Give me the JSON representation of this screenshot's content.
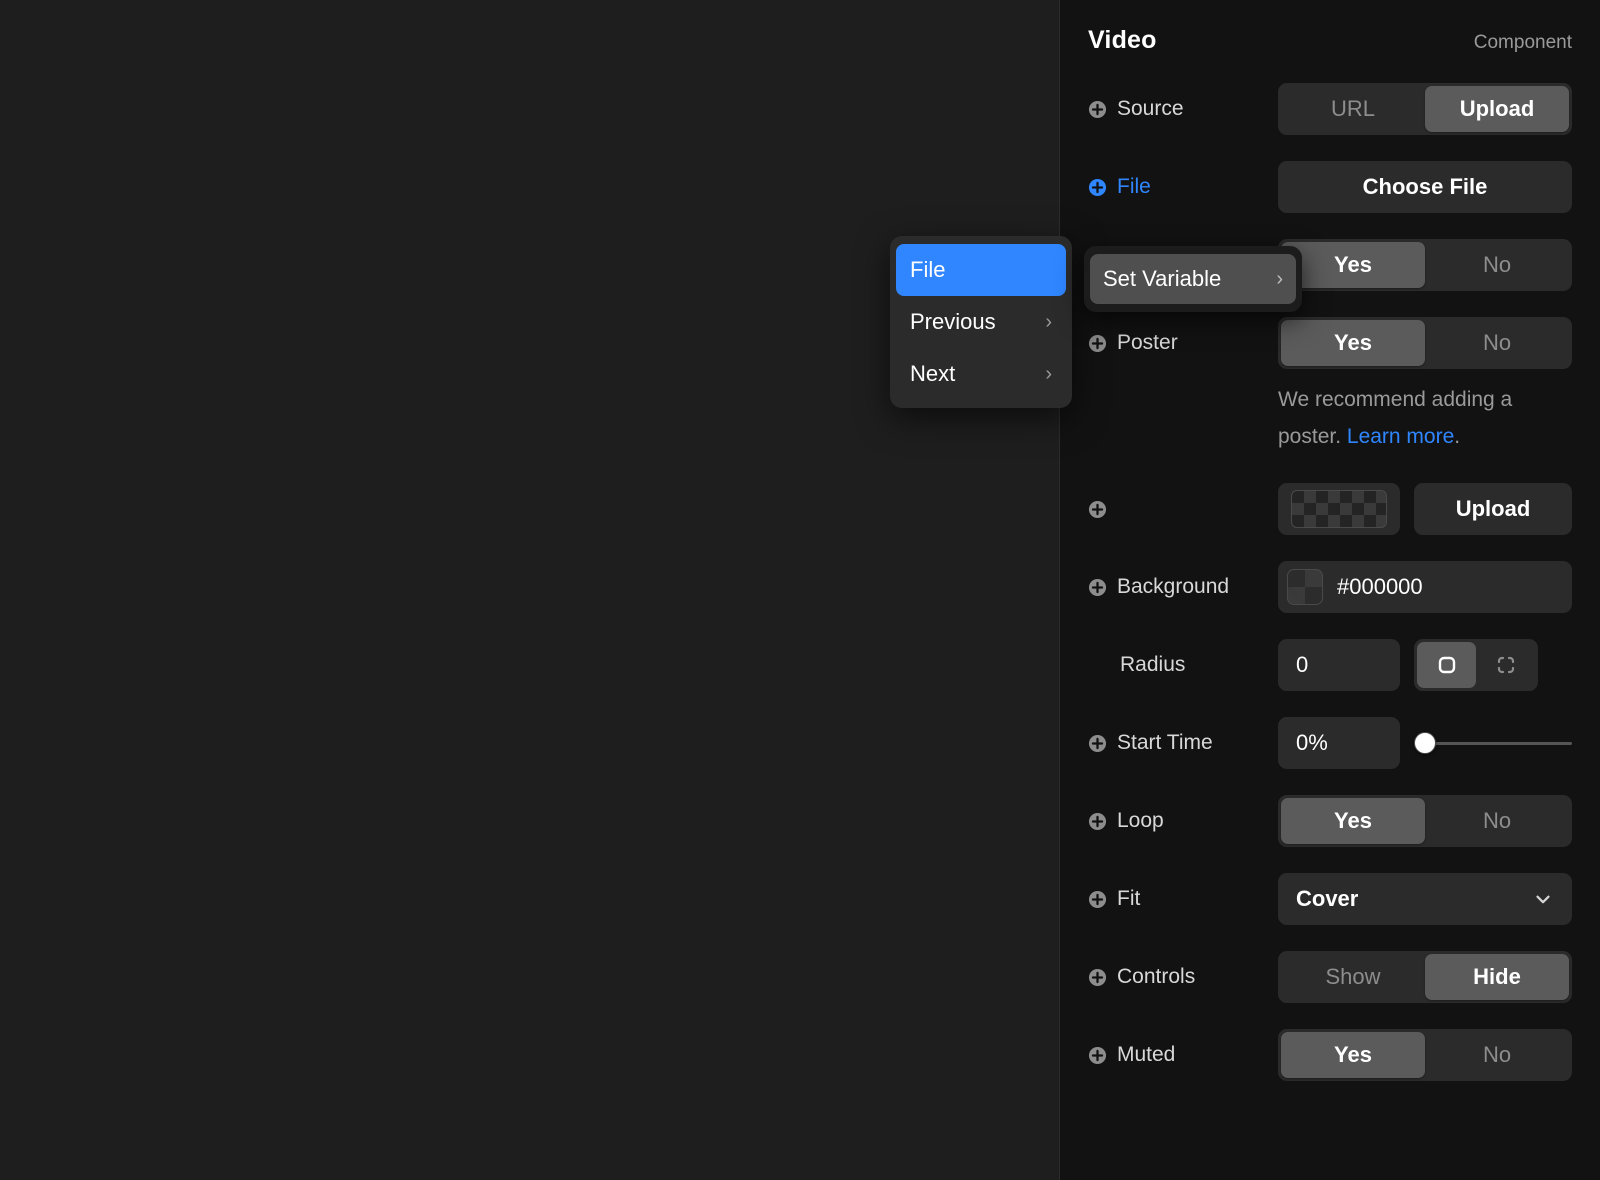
{
  "panel": {
    "title": "Video",
    "kind": "Component"
  },
  "rows": {
    "source": {
      "label": "Source",
      "options": [
        "URL",
        "Upload"
      ],
      "selected": "Upload"
    },
    "file": {
      "label": "File",
      "button": "Choose File"
    },
    "set_variable_row": {
      "options": [
        "Yes",
        "No"
      ],
      "selected": "Yes"
    },
    "poster": {
      "label": "Poster",
      "options": [
        "Yes",
        "No"
      ],
      "selected": "Yes"
    },
    "poster_hint": {
      "text_before": "We recommend adding a poster. ",
      "link": "Learn more",
      "text_after": "."
    },
    "poster_upload": {
      "button": "Upload"
    },
    "background": {
      "label": "Background",
      "value": "#000000"
    },
    "radius": {
      "label": "Radius",
      "value": "0",
      "modes": [
        "uniform",
        "individual"
      ],
      "selected": "uniform"
    },
    "start_time": {
      "label": "Start Time",
      "value": "0%",
      "slider_percent": 0
    },
    "loop": {
      "label": "Loop",
      "options": [
        "Yes",
        "No"
      ],
      "selected": "Yes"
    },
    "fit": {
      "label": "Fit",
      "value": "Cover"
    },
    "controls": {
      "label": "Controls",
      "options": [
        "Show",
        "Hide"
      ],
      "selected": "Hide"
    },
    "muted": {
      "label": "Muted",
      "options": [
        "Yes",
        "No"
      ],
      "selected": "Yes"
    }
  },
  "context_menu": {
    "items": [
      {
        "label": "File",
        "selected": true,
        "has_submenu": false
      },
      {
        "label": "Previous",
        "selected": false,
        "has_submenu": true
      },
      {
        "label": "Next",
        "selected": false,
        "has_submenu": true
      }
    ]
  },
  "set_variable_popover": {
    "label": "Set Variable",
    "has_submenu": true
  },
  "colors": {
    "accent": "#2f86ff",
    "panel_bg": "#121212",
    "canvas_bg": "#1e1e1e",
    "control_bg": "#2b2b2b",
    "active_seg": "#5b5b5b"
  }
}
